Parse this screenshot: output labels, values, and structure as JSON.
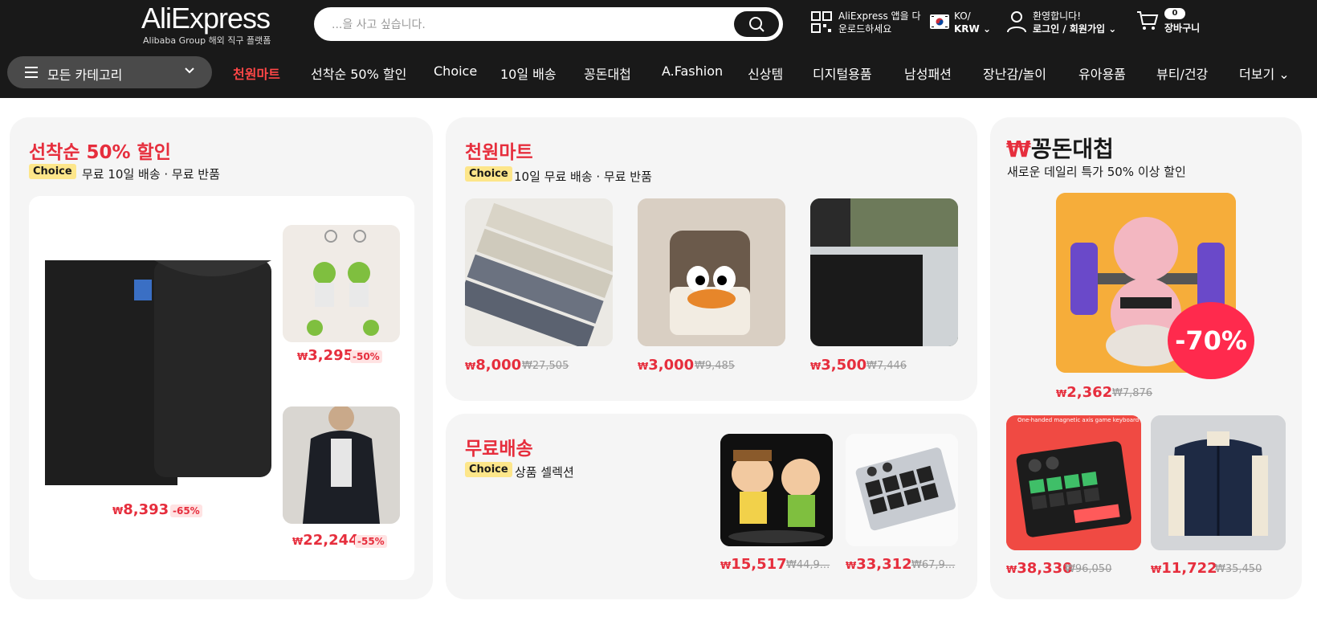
{
  "header": {
    "logo_text": "AliExpress",
    "logo_sub": "Alibaba Group 해외 직구 플랫폼",
    "search_placeholder": "...을 사고 싶습니다.",
    "app_line1": "AliExpress 앱을 다",
    "app_line2": "운로드하세요",
    "lang": "KO/",
    "currency": "KRW",
    "welcome": "환영합니다!",
    "login": "로그인 / 회원가입",
    "cart_count": "0",
    "cart_label": "장바구니"
  },
  "nav": {
    "categories_label": "모든 카테고리",
    "items": [
      "천원마트",
      "선착순 50% 할인",
      "Choice",
      "10일 배송",
      "꽁돈대첩",
      "A.Fashion",
      "신상템",
      "디지털용품",
      "남성패션",
      "장난감/놀이",
      "유아용품",
      "뷰티/건강",
      "더보기"
    ]
  },
  "colors": {
    "accent": "#e62e3d",
    "header_bg": "#191919",
    "choice_bg": "#fde68a"
  },
  "card1": {
    "title": "선착순 50% 할인",
    "choice": "Choice",
    "subtitle": "무료 10일 배송 · 무료 반품",
    "products": [
      {
        "price": "8,393",
        "discount": "-65%"
      },
      {
        "price": "3,295",
        "discount": "-50%"
      },
      {
        "price": "22,244",
        "discount": "-55%"
      }
    ]
  },
  "card2": {
    "title": "천원마트",
    "choice": "Choice",
    "subtitle": "10일 무료 배송 · 무료 반품",
    "products": [
      {
        "price": "8,000",
        "old": "₩27,505"
      },
      {
        "price": "3,000",
        "old": "₩9,485"
      },
      {
        "price": "3,500",
        "old": "₩7,446"
      }
    ]
  },
  "card3": {
    "title": "무료배송",
    "choice": "Choice",
    "subtitle": "상품 셀렉션",
    "products": [
      {
        "price": "15,517",
        "old": "₩44,9..."
      },
      {
        "price": "33,312",
        "old": "₩67,9..."
      }
    ]
  },
  "card4": {
    "logo_w": "₩",
    "logo_text": "꽁돈대첩",
    "subtitle": "새로운 데일리 특가 50% 이상 할인",
    "badge": "-70%",
    "products": [
      {
        "price": "2,362",
        "old": "₩7,876"
      },
      {
        "price": "38,330",
        "old": "₩96,050"
      },
      {
        "price": "11,722",
        "old": "₩35,450"
      }
    ],
    "keyboard_caption": "One-handed magnetic axis game keyboard"
  },
  "currency_symbol": "₩"
}
